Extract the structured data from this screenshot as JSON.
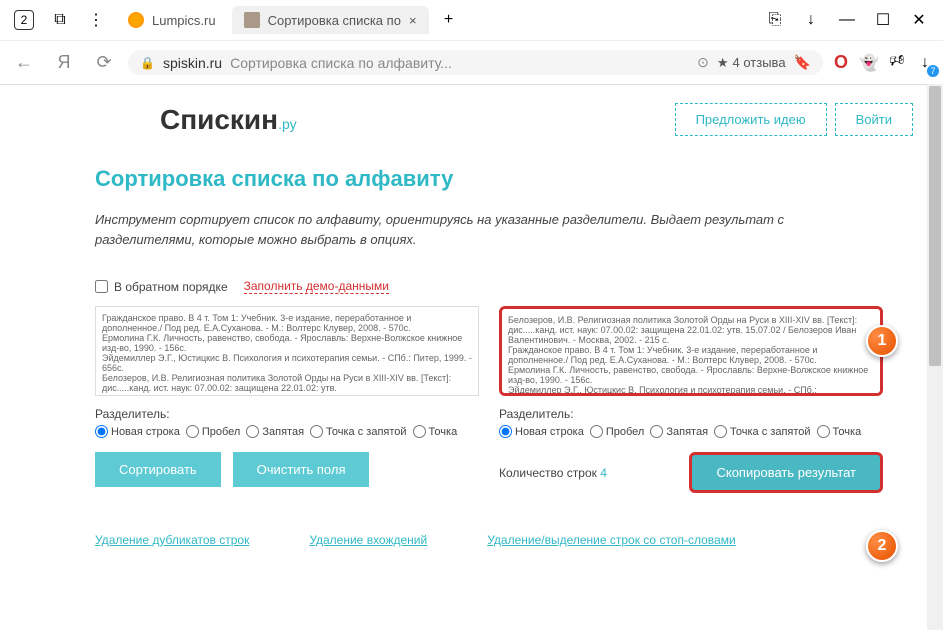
{
  "browser": {
    "home_badge": "2",
    "tabs": [
      {
        "label": "Lumpics.ru"
      },
      {
        "label": "Сортировка списка по"
      }
    ],
    "new_tab": "+",
    "url_domain": "spiskin.ru",
    "url_title": "Сортировка списка по алфавиту...",
    "reviews": "4 отзыва"
  },
  "header": {
    "logo_main": "Спискин",
    "logo_suffix": ".ру",
    "suggest_btn": "Предложить идею",
    "login_btn": "Войти"
  },
  "page": {
    "title": "Сортировка списка по алфавиту",
    "description": "Инструмент сортирует список по алфавиту, ориентируясь на указанные разделители. Выдает результат с разделителями, которые можно выбрать в опциях.",
    "reverse_label": "В обратном порядке",
    "demo_link": "Заполнить демо-данными"
  },
  "input": {
    "text": "Гражданское право. В 4 т. Том 1: Учебник. 3-е издание, переработанное и дополненное./ Под ред. Е.А.Суханова. - М.: Волтерс Клувер, 2008. - 570с.\nЕрмолина Г.К. Личность, равенство, свобода. - Ярославль: Верхне-Волжское книжное изд-во, 1990. - 156с.\nЭйдемиллер Э.Г., Юстицкис В. Психология и психотерапия семьи. - СПб.: Питер, 1999. - 656с.\nБелозеров, И.В. Религиозная политика Золотой Орды на Руси в XIII-XIV вв. [Текст]: дис.....канд. ист. наук: 07.00.02: защищена 22.01.02: утв.",
    "separator_label": "Разделитель:",
    "separators": [
      "Новая строка",
      "Пробел",
      "Запятая",
      "Точка с запятой",
      "Точка"
    ],
    "sort_btn": "Сортировать",
    "clear_btn": "Очистить поля"
  },
  "output": {
    "text": "Белозеров, И.В. Религиозная политика Золотой Орды на Руси в XIII-XIV вв. [Текст]: дис.....канд. ист. наук: 07.00.02: защищена 22.01.02: утв. 15.07.02 / Белозеров Иван Валентинович. - Москва, 2002. - 215 с.\nГражданское право. В 4 т. Том 1: Учебник. 3-е издание, переработанное и дополненное./ Под ред. Е.А.Суханова. - М.: Волтерс Клувер, 2008. - 570с.\nЕрмолина Г.К. Личность, равенство, свобода. - Ярославль: Верхне-Волжское книжное изд-во, 1990. - 156с.\nЭйдемиллер Э.Г., Юстицкис В. Психология и психотерапия семьи. - СПб.:",
    "separator_label": "Разделитель:",
    "count_label": "Количество строк",
    "count_value": "4",
    "copy_btn": "Скопировать результат"
  },
  "footer_links": [
    "Удаление дубликатов строк",
    "Удаление вхождений",
    "Удаление/выделение строк со стоп-словами"
  ],
  "callouts": {
    "one": "1",
    "two": "2"
  }
}
